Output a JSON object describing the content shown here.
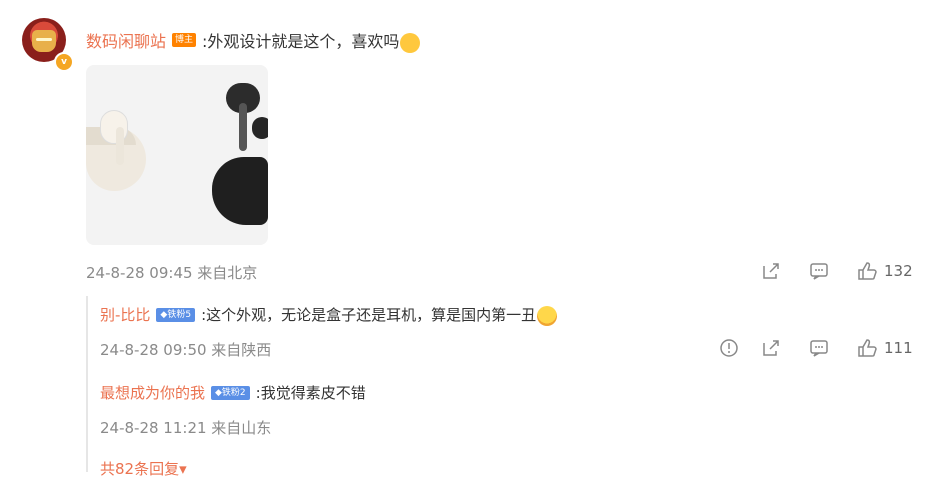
{
  "comment": {
    "username": "数码闲聊站",
    "tag": "博主",
    "text": ":外观设计就是这个，喜欢吗",
    "emoji": "face-icon",
    "time": "24-8-28 09:45 来自北京",
    "likes": "132"
  },
  "replies": [
    {
      "username": "别-比比",
      "fan_tag": "◆铁粉5",
      "text": ":这个外观，无论是盒子还是耳机，算是国内第一丑",
      "time": "24-8-28 09:50 来自陕西",
      "likes": "111"
    },
    {
      "username": "最想成为你的我",
      "fan_tag": "◆铁粉2",
      "text": ":我觉得素皮不错",
      "time": "24-8-28 11:21 来自山东"
    }
  ],
  "more_replies": "共82条回复▾",
  "colors": {
    "accent": "#eb7350",
    "tag": "#ff8200",
    "fan_tag": "#5a8fe6"
  }
}
